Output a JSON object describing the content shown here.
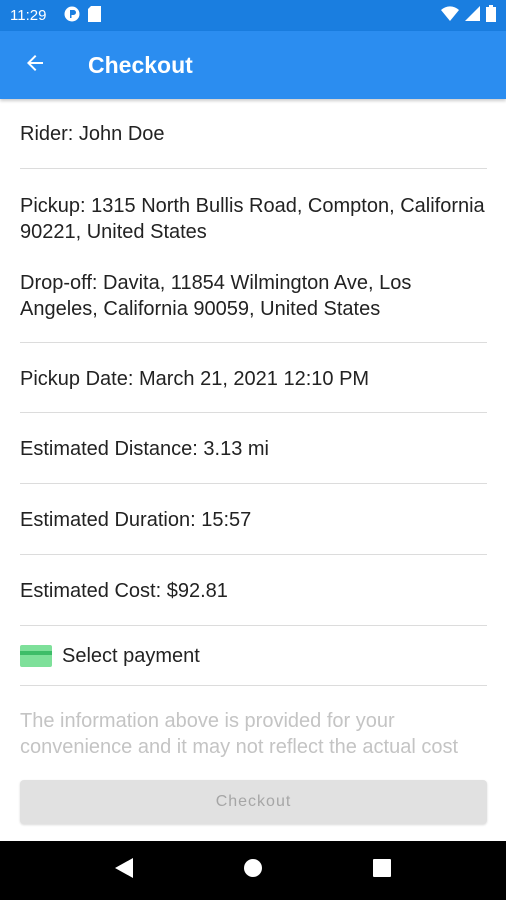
{
  "status_bar": {
    "time": "11:29",
    "icons": [
      "app-notification-icon",
      "sd-card-icon",
      "wifi-icon",
      "cell-signal-icon",
      "battery-icon"
    ]
  },
  "app_bar": {
    "title": "Checkout",
    "back_icon": "arrow-left-icon",
    "color": "#2b8df0"
  },
  "trip": {
    "rider": "Rider: John Doe",
    "pickup": "Pickup: 1315 North Bullis Road, Compton, California 90221, United States",
    "dropoff": "Drop-off: Davita, 11854 Wilmington Ave, Los Angeles, California 90059, United States",
    "pickup_date": "Pickup Date: March 21, 2021 12:10 PM",
    "distance": "Estimated Distance: 3.13 mi",
    "duration": "Estimated Duration: 15:57",
    "cost": "Estimated Cost: $92.81"
  },
  "payment": {
    "label": "Select payment",
    "icon": "credit-card-icon",
    "icon_color": "#7ee09a"
  },
  "disclaimer": "The information above is provided for your convenience and it may not reflect the actual cost",
  "checkout_button": {
    "label": "Checkout",
    "state": "disabled"
  },
  "nav_bar": {
    "icons": [
      "back-triangle-icon",
      "home-circle-icon",
      "recents-square-icon"
    ]
  }
}
